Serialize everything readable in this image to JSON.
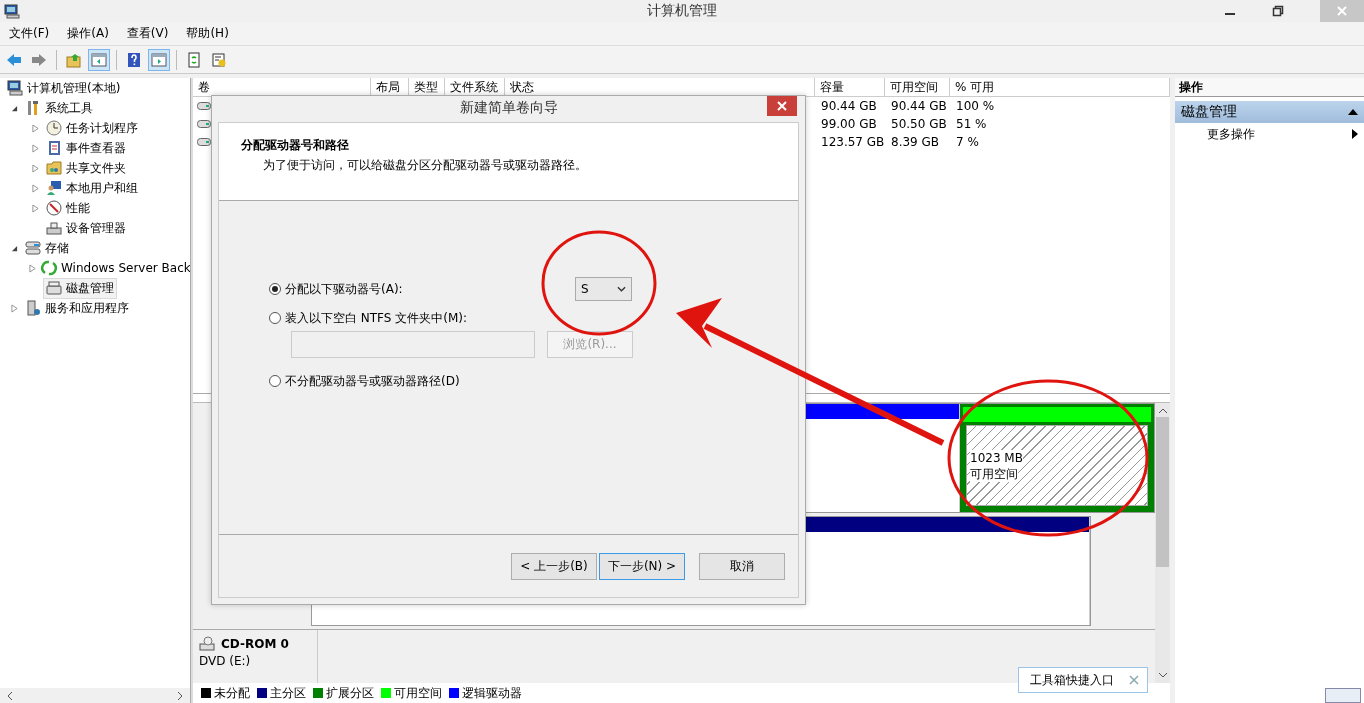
{
  "window": {
    "title": "计算机管理"
  },
  "menu": [
    "文件(F)",
    "操作(A)",
    "查看(V)",
    "帮助(H)"
  ],
  "toolbar": [
    {
      "kind": "back",
      "pressed": false
    },
    {
      "kind": "forward",
      "pressed": false
    },
    {
      "kind": "up",
      "pressed": false
    },
    {
      "kind": "tree",
      "pressed": true
    },
    {
      "kind": "help",
      "pressed": false
    },
    {
      "kind": "pane",
      "pressed": true
    },
    {
      "kind": "refresh",
      "pressed": false
    },
    {
      "kind": "export",
      "pressed": false
    }
  ],
  "tree": [
    {
      "label": "计算机管理(本地)",
      "selected": false,
      "children": [
        {
          "label": "系统工具",
          "expanded": true,
          "selected": false,
          "children": [
            {
              "label": "任务计划程序",
              "expanded": false,
              "selected": false
            },
            {
              "label": "事件查看器",
              "expanded": false,
              "selected": false
            },
            {
              "label": "共享文件夹",
              "expanded": false,
              "selected": false
            },
            {
              "label": "本地用户和组",
              "expanded": false,
              "selected": false
            },
            {
              "label": "性能",
              "expanded": false,
              "selected": false
            },
            {
              "label": "设备管理器",
              "selected": false
            }
          ]
        },
        {
          "label": "存储",
          "expanded": true,
          "selected": false,
          "children": [
            {
              "label": "Windows Server Back",
              "expanded": false,
              "selected": false
            },
            {
              "label": "磁盘管理",
              "selected": true
            }
          ]
        },
        {
          "label": "服务和应用程序",
          "expanded": false,
          "selected": false
        }
      ]
    }
  ],
  "table": {
    "columns": [
      "卷",
      "布局",
      "类型",
      "文件系统",
      "状态",
      "容量",
      "可用空间",
      "% 可用"
    ],
    "rows": [
      {
        "capacity": "90.44 GB",
        "free": "90.44 GB",
        "percent_free": "100 %"
      },
      {
        "capacity": "99.00 GB",
        "free": "50.50 GB",
        "percent_free": "51 %"
      },
      {
        "capacity": "123.57 GB",
        "free": "8.39 GB",
        "percent_free": "7 %"
      }
    ]
  },
  "disks": [
    {
      "partitions": [
        {
          "kind": "logical",
          "color": "#0000ff"
        },
        {
          "kind": "extended",
          "color": "#008000",
          "children": [
            {
              "kind": "free",
              "color": "#00ff00",
              "size": "1023 MB",
              "status": "可用空间"
            }
          ]
        }
      ]
    },
    {
      "partitions": [
        {
          "kind": "primary",
          "color": "#000080"
        }
      ]
    }
  ],
  "cdrom": {
    "name": "CD-ROM 0",
    "media": "DVD (E:)"
  },
  "legend": [
    {
      "label": "未分配",
      "color": "#000000"
    },
    {
      "label": "主分区",
      "color": "#000080"
    },
    {
      "label": "扩展分区",
      "color": "#008000"
    },
    {
      "label": "可用空间",
      "color": "#00ff00"
    },
    {
      "label": "逻辑驱动器",
      "color": "#0000ff"
    }
  ],
  "actions": {
    "title": "操作",
    "section": {
      "label": "磁盘管理",
      "expanded": true
    },
    "items": [
      "更多操作"
    ]
  },
  "dialog": {
    "title": "新建简单卷向导",
    "heading": "分配驱动器号和路径",
    "subtitle": "为了便于访问，可以给磁盘分区分配驱动器号或驱动器路径。",
    "options": [
      {
        "label": "分配以下驱动器号(A):",
        "selected": true
      },
      {
        "label": "装入以下空白 NTFS 文件夹中(M):",
        "selected": false
      },
      {
        "label": "不分配驱动器号或驱动器路径(D)",
        "selected": false
      }
    ],
    "drive_letter": "S",
    "folder_field": {
      "disabled": true
    },
    "browse_button": {
      "label": "浏览(R)...",
      "disabled": true
    },
    "buttons": [
      {
        "label": "< 上一步(B)",
        "focused": false
      },
      {
        "label": "下一步(N) >",
        "focused": true
      },
      {
        "label": "取消",
        "focused": false
      }
    ]
  },
  "tooltip": {
    "text": "工具箱快捷入口"
  }
}
